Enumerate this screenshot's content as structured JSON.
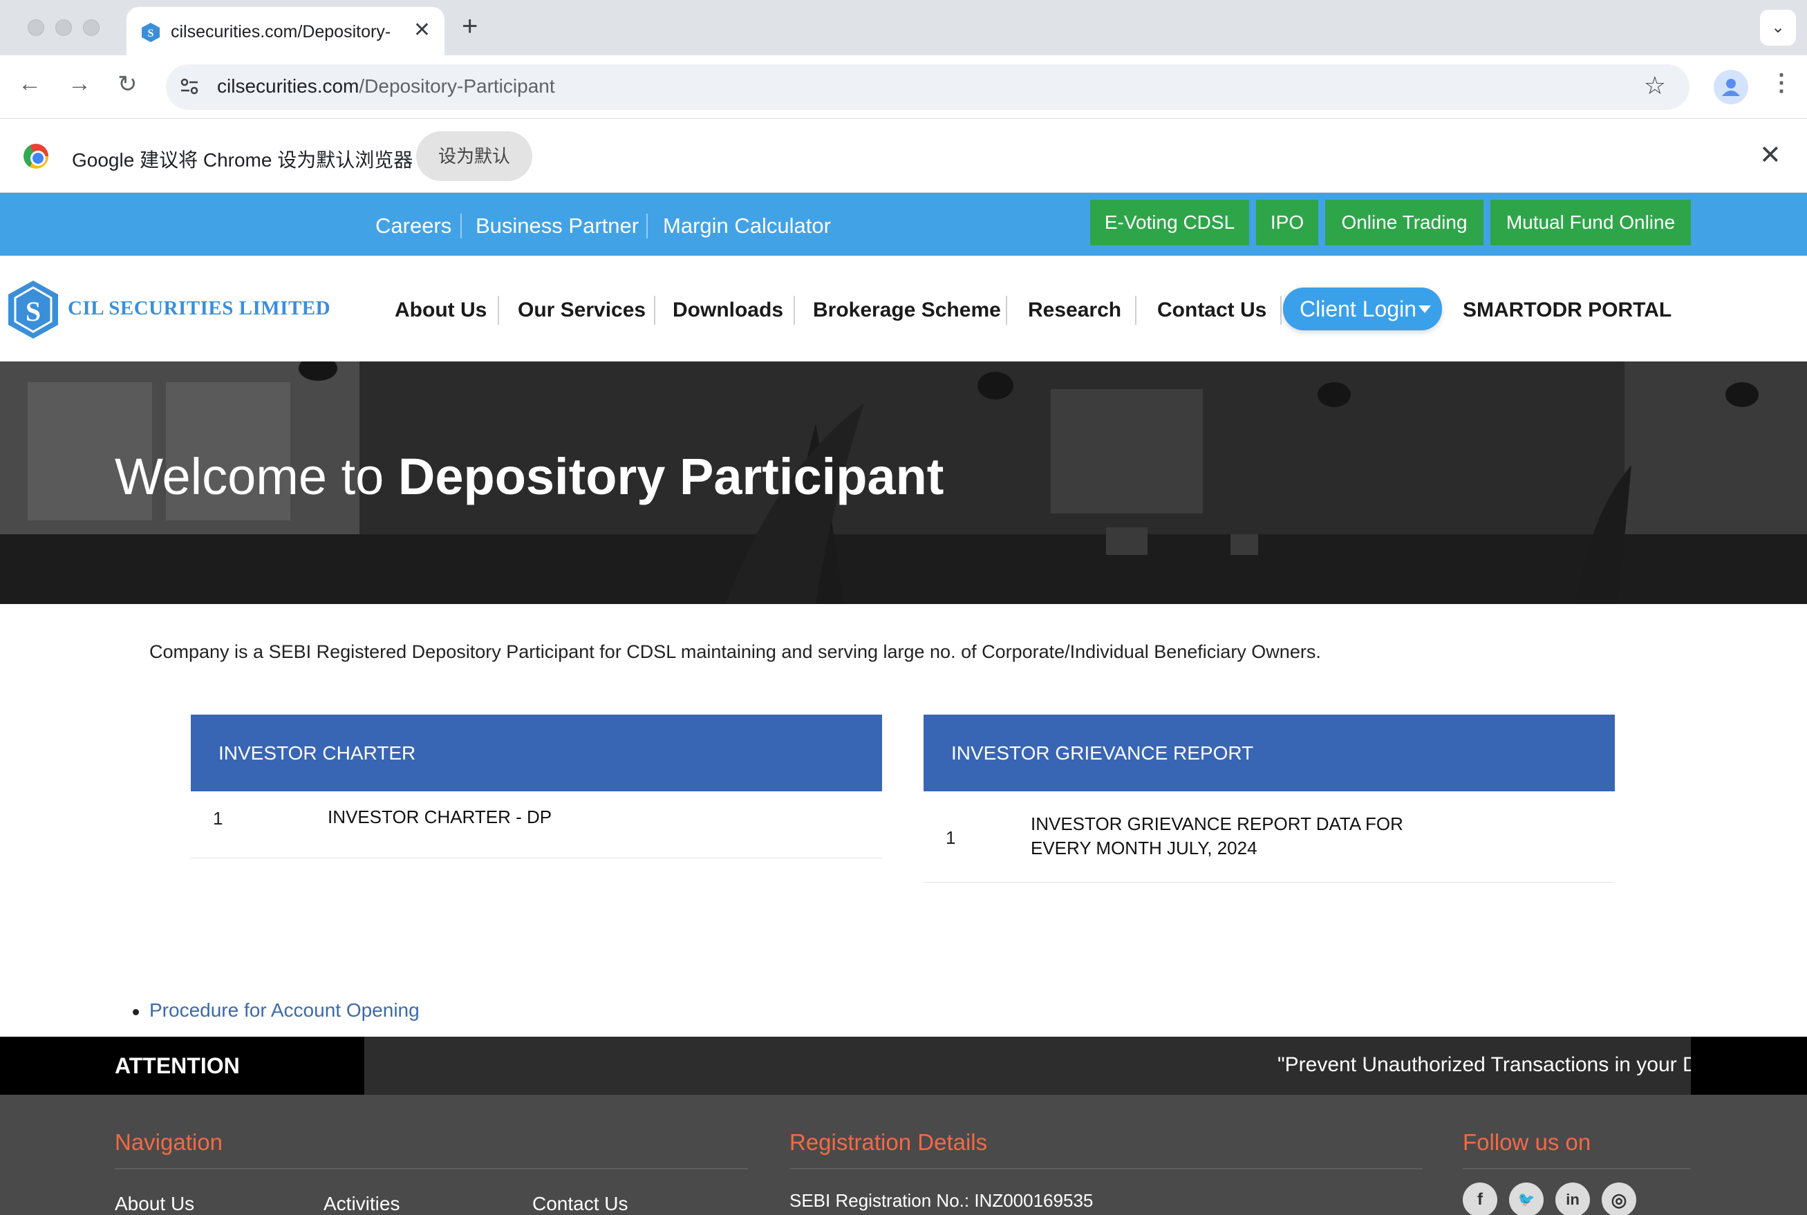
{
  "browser": {
    "tab_title": "cilsecurities.com/Depository-",
    "tab_close": "✕",
    "new_tab": "+",
    "tab_search": "⌄",
    "back": "←",
    "forward": "→",
    "reload": "↻",
    "url_domain": "cilsecurities.com",
    "url_path": "/Depository-Participant",
    "star": "☆",
    "menu": "⋮",
    "infobar_text": "Google 建议将 Chrome 设为默认浏览器",
    "infobar_button": "设为默认",
    "infobar_close": "✕"
  },
  "topbar": {
    "links": [
      "Careers",
      "Business Partner",
      "Margin Calculator"
    ],
    "buttons": [
      "E-Voting CDSL",
      "IPO",
      "Online Trading",
      "Mutual Fund Online"
    ],
    "button_color": "#2fa54a",
    "background": "#42a2e6"
  },
  "nav": {
    "logo_text": "CIL SECURITIES LIMITED",
    "items": [
      "About Us",
      "Our Services",
      "Downloads",
      "Brokerage Scheme",
      "Research",
      "Contact Us"
    ],
    "client_login": "Client Login",
    "portal": "SMARTODR PORTAL"
  },
  "hero": {
    "title_prefix": "Welcome to",
    "title_bold": "Depository Participant"
  },
  "intro": "Company is a SEBI Registered Depository Participant for CDSL maintaining and serving large no. of Corporate/Individual Beneficiary Owners.",
  "panels": [
    {
      "heading": "INVESTOR CHARTER",
      "rows": [
        {
          "num": "1",
          "text": "INVESTOR CHARTER - DP"
        }
      ]
    },
    {
      "heading": "INVESTOR GRIEVANCE REPORT",
      "rows": [
        {
          "num": "1",
          "line1": "INVESTOR GRIEVANCE REPORT DATA FOR",
          "line2": "EVERY MONTH JULY, 2024"
        }
      ]
    }
  ],
  "procedure_link": "Procedure for Account Opening",
  "attention": {
    "label": "ATTENTION INVESTOR:",
    "ticker": "\"Prevent Unauthorized Transactions in your D"
  },
  "footer": {
    "navigation_heading": "Navigation",
    "nav_links": [
      "About Us",
      "Activities",
      "Contact Us"
    ],
    "registration_heading": "Registration Details",
    "sebi_registration": "SEBI Registration No.: INZ000169535",
    "follow_heading": "Follow us on",
    "social": [
      {
        "name": "facebook-icon",
        "glyph": "f"
      },
      {
        "name": "twitter-icon",
        "glyph": "🐦"
      },
      {
        "name": "linkedin-icon",
        "glyph": "in"
      },
      {
        "name": "instagram-icon",
        "glyph": "◎"
      }
    ],
    "accent": "#f26a46"
  }
}
